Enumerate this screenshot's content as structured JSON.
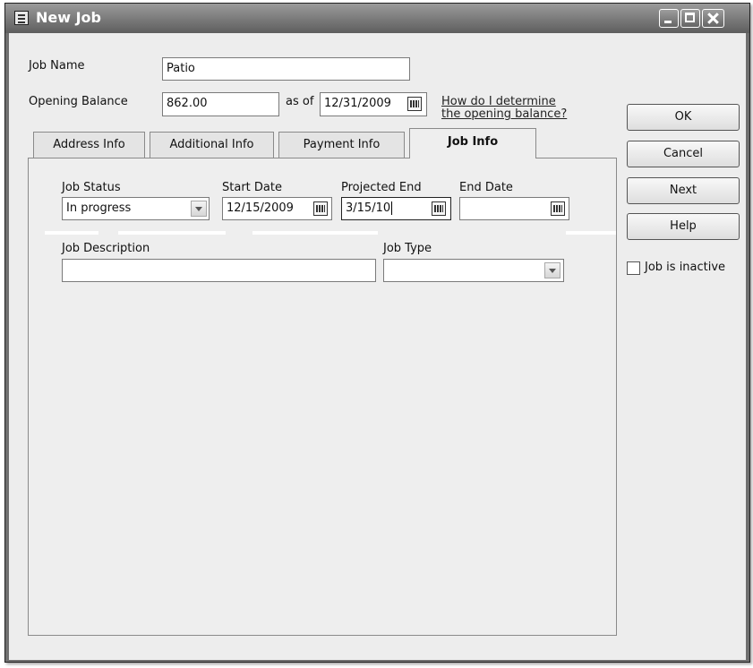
{
  "window": {
    "title": "New Job"
  },
  "form": {
    "job_name": {
      "label": "Job Name",
      "value": "Patio"
    },
    "opening_balance": {
      "label": "Opening Balance",
      "value": "862.00"
    },
    "as_of": {
      "label": "as of",
      "value": "12/31/2009"
    },
    "help_link": {
      "line1": "How do I determine",
      "line2": "the opening balance?"
    }
  },
  "tabs": [
    {
      "label": "Address Info"
    },
    {
      "label": "Additional Info"
    },
    {
      "label": "Payment Info"
    },
    {
      "label": "Job Info",
      "active": true
    }
  ],
  "job_info": {
    "job_status": {
      "label": "Job Status",
      "value": "In progress"
    },
    "start_date": {
      "label": "Start Date",
      "value": "12/15/2009"
    },
    "projected_end": {
      "label": "Projected End",
      "value": "3/15/10"
    },
    "end_date": {
      "label": "End Date",
      "value": ""
    },
    "job_description": {
      "label": "Job Description",
      "value": ""
    },
    "job_type": {
      "label": "Job Type",
      "value": ""
    }
  },
  "buttons": {
    "ok": "OK",
    "cancel": "Cancel",
    "next": "Next",
    "help": "Help"
  },
  "inactive": {
    "label": "Job is inactive",
    "checked": false
  }
}
